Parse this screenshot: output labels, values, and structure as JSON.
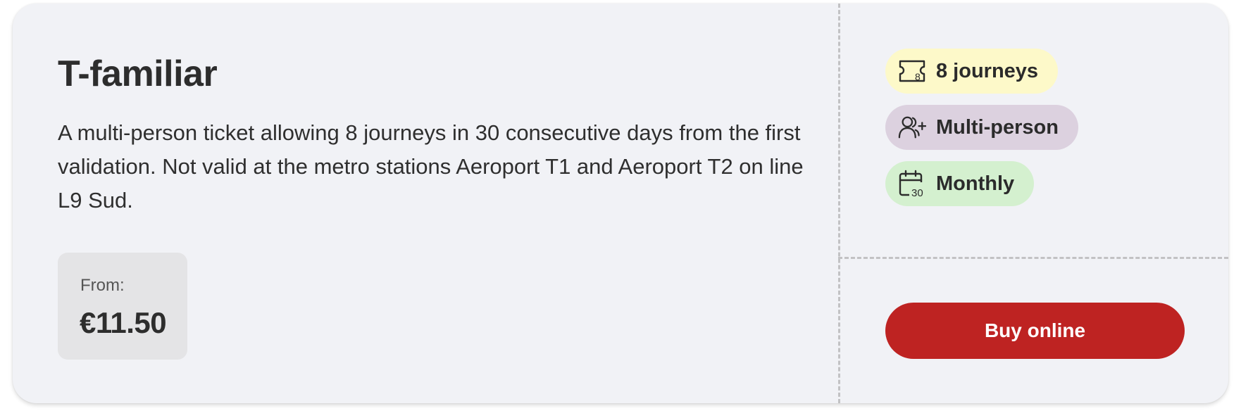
{
  "ticket": {
    "title": "T-familiar",
    "description": "A multi-person ticket allowing 8 journeys in 30 consecutive days from the first validation. Not valid at the metro stations Aeroport T1 and Aeroport T2 on line L9 Sud.",
    "price": {
      "label": "From:",
      "value": "€11.50"
    }
  },
  "chips": [
    {
      "label": "8 journeys",
      "icon": "ticket-icon",
      "icon_text": "8",
      "color": "#fdf9c9"
    },
    {
      "label": "Multi-person",
      "icon": "users-plus-icon",
      "color": "#dcd1df"
    },
    {
      "label": "Monthly",
      "icon": "calendar-icon",
      "icon_text": "30",
      "color": "#d4f0cf"
    }
  ],
  "buy_button": {
    "label": "Buy online",
    "color": "#be2322"
  }
}
